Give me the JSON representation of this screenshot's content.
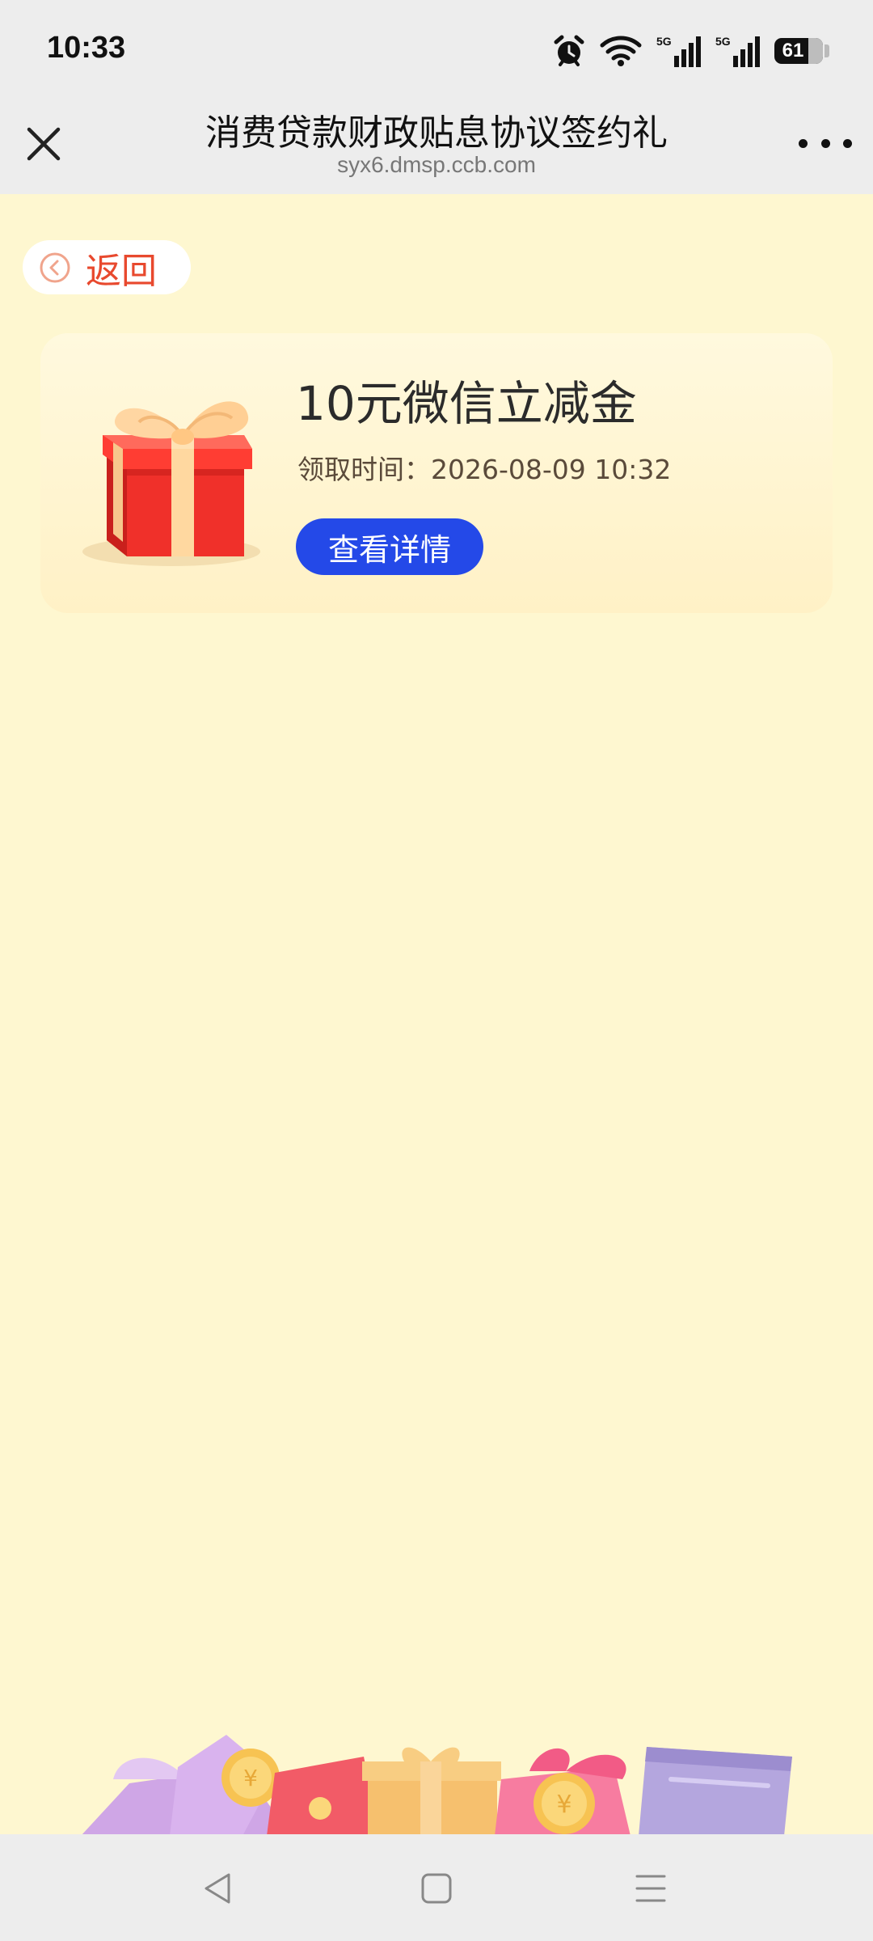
{
  "status_bar": {
    "time": "10:33",
    "alarm_icon": "alarm-clock-icon",
    "wifi_icon": "wifi-icon",
    "sim1": {
      "tag": "5G",
      "icon": "signal-icon"
    },
    "sim2": {
      "tag": "5G",
      "icon": "signal-icon"
    },
    "battery": "61"
  },
  "header": {
    "title": "消费贷款财政贴息协议签约礼",
    "domain": "syx6.dmsp.ccb.com",
    "close_icon": "close-icon",
    "more_icon": "more-horizontal-icon"
  },
  "back": {
    "label": "返回",
    "icon": "chevron-left-circle-icon",
    "color": "#E8492E"
  },
  "gift_card": {
    "title": "10元微信立减金",
    "time_label": "领取时间：",
    "time_value": "2026-08-09 10:32",
    "button_label": "查看详情",
    "button_color": "#2449E8",
    "icon": "gift-box-icon"
  },
  "decoration": {
    "icon": "gifts-and-coins-banner"
  },
  "nav": {
    "back_icon": "nav-back-icon",
    "home_icon": "nav-home-icon",
    "menu_icon": "nav-menu-icon"
  },
  "colors": {
    "page_background": "#FEF7D0",
    "chrome_background": "#EDEDED"
  }
}
